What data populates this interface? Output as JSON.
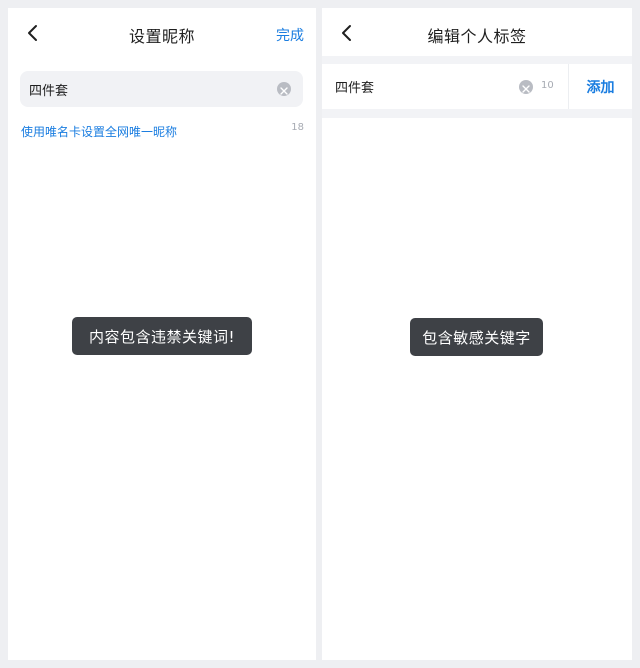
{
  "left_screen": {
    "title": "设置昵称",
    "done_label": "完成",
    "nickname_value": "四件套",
    "unique_nickname_link": "使用唯名卡设置全网唯一昵称",
    "char_count": "18",
    "toast_message": "内容包含违禁关键词!"
  },
  "right_screen": {
    "title": "编辑个人标签",
    "tag_value": "四件套",
    "char_count": "10",
    "add_label": "添加",
    "toast_message": "包含敏感关键字"
  },
  "icons": {
    "back": "chevron-left-icon",
    "clear": "clear-circle-icon"
  },
  "colors": {
    "accent": "#1a7de0",
    "toast_bg": "#34373c",
    "field_bg": "#f1f2f5",
    "page_bg": "#eeeff2"
  }
}
